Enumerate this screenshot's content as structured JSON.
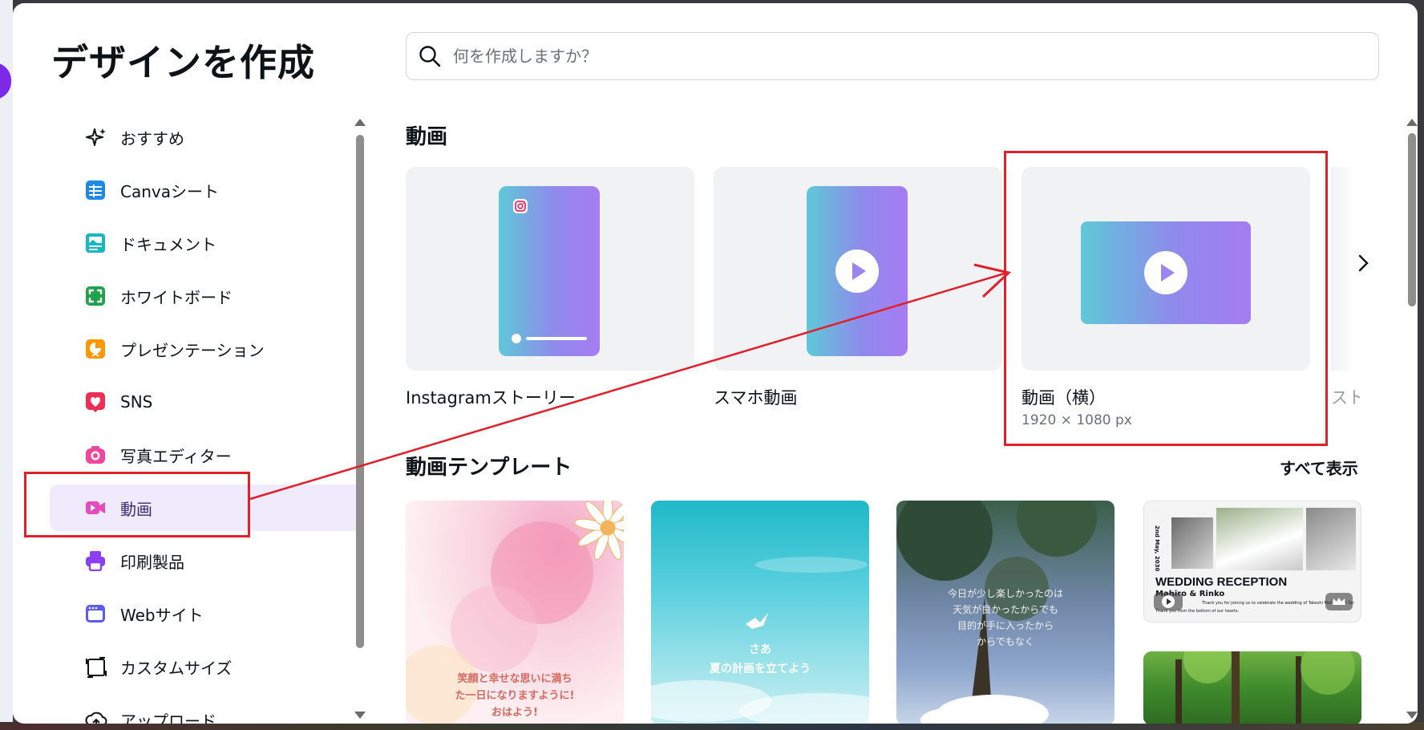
{
  "modal": {
    "title": "デザインを作成",
    "search": {
      "placeholder": "何を作成しますか？"
    }
  },
  "nav": {
    "items": [
      {
        "label": "おすすめ",
        "icon": "sparkles-icon",
        "color": "#0e1318"
      },
      {
        "label": "Canvaシート",
        "icon": "sheet-icon",
        "color": "#1e88e5"
      },
      {
        "label": "ドキュメント",
        "icon": "document-icon",
        "color": "#14b8c4"
      },
      {
        "label": "ホワイトボード",
        "icon": "whiteboard-icon",
        "color": "#1ea34a"
      },
      {
        "label": "プレゼンテーション",
        "icon": "presentation-icon",
        "color": "#ff9800"
      },
      {
        "label": "SNS",
        "icon": "heart-icon",
        "color": "#ef2d56"
      },
      {
        "label": "写真エディター",
        "icon": "camera-icon",
        "color": "#f0479b"
      },
      {
        "label": "動画",
        "icon": "video-icon",
        "color": "#e64bbd",
        "active": true
      },
      {
        "label": "印刷製品",
        "icon": "printer-icon",
        "color": "#8b3ff0"
      },
      {
        "label": "Webサイト",
        "icon": "website-icon",
        "color": "#5b5bf2"
      },
      {
        "label": "カスタムサイズ",
        "icon": "custom-size-icon",
        "color": "#0e1318"
      },
      {
        "label": "アップロード",
        "icon": "upload-icon",
        "color": "#0e1318"
      }
    ]
  },
  "video_section": {
    "title": "動画",
    "cards": [
      {
        "label": "Instagramストーリー",
        "icon": "instagram-icon"
      },
      {
        "label": "スマホ動画"
      },
      {
        "label": "動画（横）",
        "size": "1920 × 1080 px"
      },
      {
        "label": "スト"
      }
    ]
  },
  "templates_section": {
    "title": "動画テンプレート",
    "show_all": "すべて表示",
    "templates": [
      {
        "text_lines": [
          "笑顔と幸せな思いに満ち",
          "た一日になりますように!",
          "おはよう!"
        ]
      },
      {
        "text_lines": [
          "さあ",
          "夏の計画を立てよう"
        ]
      },
      {
        "text_lines": [
          "今日が少し楽しかったのは",
          "天気が良かったからでも",
          "目的が手に入ったから",
          "からでもなく"
        ]
      },
      {
        "title": "WEDDING RECEPTION",
        "subtitle": "Mahiro & Rinko",
        "date": "2nd May, 2030",
        "note": "Thank you for joining us to celebrate the wedding of Takeshi Mahiro and Taro...",
        "note2": "Thank you from the bottom of our hearts."
      },
      {
        "kind": "forest"
      }
    ]
  },
  "colors": {
    "accent": "#7d2ae8",
    "active_nav_bg": "#efeafc",
    "annotation": "#e0202a"
  }
}
